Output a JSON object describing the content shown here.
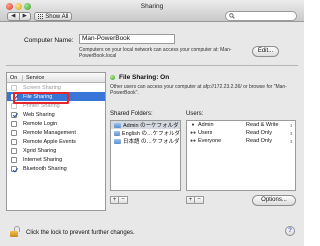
{
  "window": {
    "title": "Sharing"
  },
  "toolbar": {
    "back_glyph": "◀",
    "forward_glyph": "▶",
    "show_all_label": "Show All",
    "search_icon": "magnifier-icon"
  },
  "computer_name": {
    "label": "Computer Name:",
    "value": "Man-PowerBook",
    "description": "Computers on your local network can access your computer at: Man-PowerBook.local",
    "edit_label": "Edit..."
  },
  "services": {
    "header_on": "On",
    "header_service": "Service",
    "items": [
      {
        "label": "Screen Sharing",
        "checked": false,
        "selected": false,
        "dim": true
      },
      {
        "label": "File Sharing",
        "checked": true,
        "selected": true,
        "dim": false
      },
      {
        "label": "Printer Sharing",
        "checked": false,
        "selected": false,
        "dim": true
      },
      {
        "label": "Web Sharing",
        "checked": true,
        "selected": false,
        "dim": false
      },
      {
        "label": "Remote Login",
        "checked": false,
        "selected": false,
        "dim": false
      },
      {
        "label": "Remote Management",
        "checked": false,
        "selected": false,
        "dim": false
      },
      {
        "label": "Remote Apple Events",
        "checked": false,
        "selected": false,
        "dim": false
      },
      {
        "label": "Xgrid Sharing",
        "checked": false,
        "selected": false,
        "dim": false
      },
      {
        "label": "Internet Sharing",
        "checked": false,
        "selected": false,
        "dim": false
      },
      {
        "label": "Bluetooth Sharing",
        "checked": true,
        "selected": false,
        "dim": false
      }
    ]
  },
  "status": {
    "title": "File Sharing: On",
    "description": "Other users can access your computer at afp://172.23.2.36/ or browse for \"Man-PowerBook\".",
    "dot_color": "#3aa62a"
  },
  "shared_folders": {
    "label": "Shared Folders:",
    "items": [
      {
        "name": "Admin のーケフォルダ",
        "selected": true
      },
      {
        "name": "English の…ケフォルダ",
        "selected": false
      },
      {
        "name": "日本語 の…ケフォルダ",
        "selected": false
      }
    ]
  },
  "users": {
    "label": "Users:",
    "items": [
      {
        "icon": "single-user-icon",
        "name": "Admin",
        "permission": "Read & Write"
      },
      {
        "icon": "group-users-icon",
        "name": "Users",
        "permission": "Read Only"
      },
      {
        "icon": "group-users-icon",
        "name": "Everyone",
        "permission": "Read Only"
      }
    ]
  },
  "buttons": {
    "add": "+",
    "remove": "−",
    "options": "Options..."
  },
  "footer": {
    "lock_text": "Click the lock to prevent further changes.",
    "help": "?"
  },
  "colors": {
    "selection": "#3875d7",
    "highlight_box": "#e5262a"
  }
}
